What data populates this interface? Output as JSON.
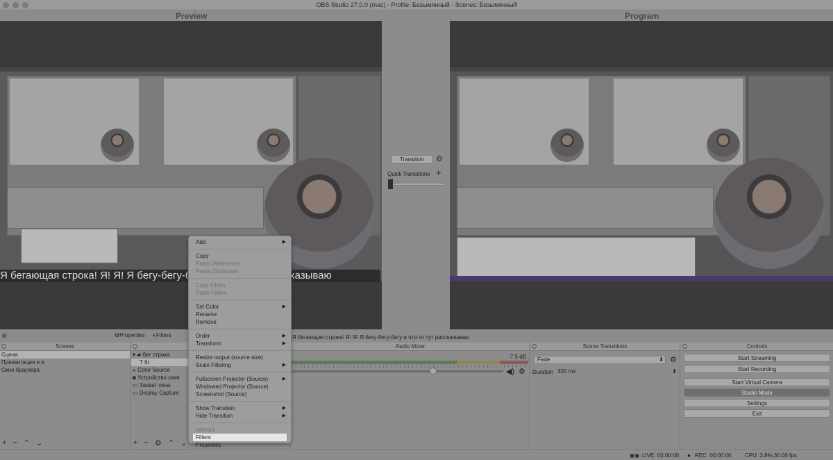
{
  "window": {
    "title": "OBS Studio 27.0.0 (mac) - Profile: Безымянный - Scenes: Безымянный"
  },
  "preview": {
    "label": "Preview",
    "ticker_text": "Я бегающая строка! Я! Я! Я бегу-бегу-бегу и что-то тут рассказываю"
  },
  "program": {
    "label": "Program"
  },
  "studio": {
    "transition_button": "Transition",
    "quick_transitions": "Quick Transitions"
  },
  "source_bar": {
    "selected_source": "бг",
    "properties": "Properties",
    "filters": "Filters",
    "text_preview": "Я бегающая строка! Я! Я! Я бегу-бегу-бегу и что-то тут рассказываю"
  },
  "scenes": {
    "title": "Scenes",
    "items": [
      "Сцена",
      "Презентация и я",
      "Окно браузера"
    ]
  },
  "sources": {
    "items": [
      "бег строка",
      "бг",
      "Color Source",
      "Устройство захв",
      "Захват окна",
      "Display Capture"
    ]
  },
  "audio_mixer": {
    "title": "Audio Mixer",
    "level": "-7.5 dB"
  },
  "scene_transitions": {
    "title": "Scene Transitions",
    "transition": "Fade",
    "duration_label": "Duration",
    "duration_value": "300 ms"
  },
  "controls": {
    "title": "Controls",
    "start_streaming": "Start Streaming",
    "start_recording": "Start Recording",
    "start_virtual_camera": "Start Virtual Camera",
    "studio_mode": "Studio Mode",
    "settings": "Settings",
    "exit": "Exit"
  },
  "context_menu": {
    "add": "Add",
    "copy": "Copy",
    "paste_reference": "Paste (Reference)",
    "paste_duplicate": "Paste (Duplicate)",
    "copy_filters": "Copy Filters",
    "paste_filters": "Paste Filters",
    "set_color": "Set Color",
    "rename": "Rename",
    "remove": "Remove",
    "order": "Order",
    "transform": "Transform",
    "resize_output": "Resize output (source size)",
    "scale_filtering": "Scale Filtering",
    "fullscreen_projector": "Fullscreen Projector (Source)",
    "windowed_projector": "Windowed Projector (Source)",
    "screenshot": "Screenshot (Source)",
    "show_transition": "Show Transition",
    "hide_transition": "Hide Transition",
    "interact": "Interact",
    "filters": "Filters",
    "properties": "Properties"
  },
  "status": {
    "live": "LIVE: 00:00:00",
    "rec": "REC: 00:00:00",
    "cpu": "CPU: 3.8%,30.00 fps"
  }
}
